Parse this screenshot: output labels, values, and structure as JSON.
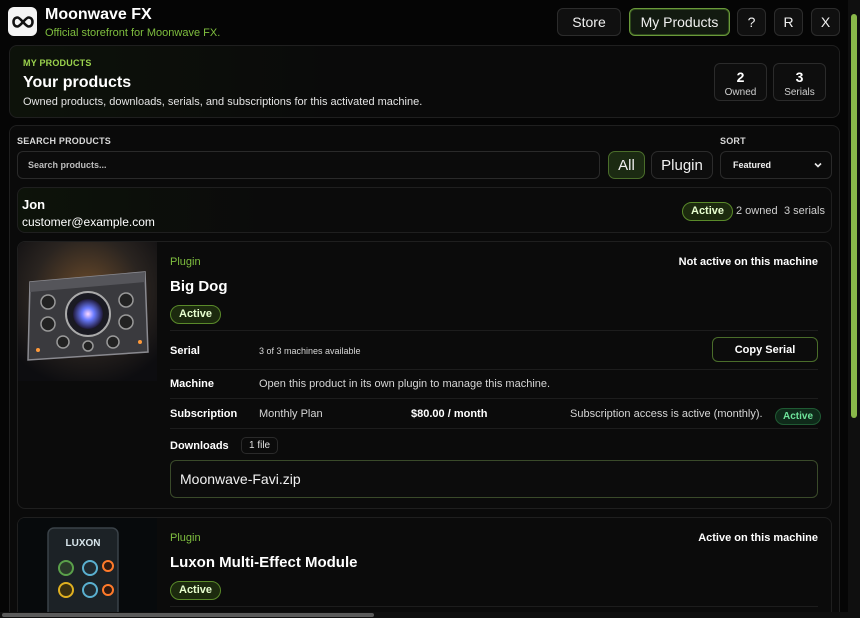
{
  "app": {
    "title": "Moonwave FX",
    "subtitle": "Official storefront for Moonwave FX."
  },
  "nav": {
    "store": "Store",
    "my_products": "My Products",
    "help": "?",
    "r": "R",
    "close": "X"
  },
  "hero": {
    "eyebrow": "MY PRODUCTS",
    "title": "Your products",
    "description": "Owned products, downloads, serials, and subscriptions for this activated machine.",
    "stats": [
      {
        "value": "2",
        "label": "Owned"
      },
      {
        "value": "3",
        "label": "Serials"
      }
    ]
  },
  "filters": {
    "search_label": "SEARCH PRODUCTS",
    "search_placeholder": "Search products...",
    "chips": [
      "All",
      "Plugin"
    ],
    "sort_label": "SORT",
    "sort_value": "Featured"
  },
  "account": {
    "name": "Jon",
    "email": "customer@example.com",
    "status": "Active",
    "owned": "2 owned",
    "serials": "3 serials"
  },
  "products": [
    {
      "category": "Plugin",
      "machine_status": "Not active on this machine",
      "title": "Big Dog",
      "status": "Active",
      "serial_label": "Serial",
      "serial_info": "3 of 3 machines available",
      "copy_serial": "Copy Serial",
      "machine_label": "Machine",
      "machine_info": "Open this product in its own plugin to manage this machine.",
      "subscription_label": "Subscription",
      "plan": "Monthly Plan",
      "price": "$80.00 / month",
      "subscription_info": "Subscription access is active (monthly).",
      "subscription_status": "Active",
      "downloads_label": "Downloads",
      "file_count": "1 file",
      "file_name": "Moonwave-Favi.zip"
    },
    {
      "category": "Plugin",
      "machine_status": "Active on this machine",
      "title": "Luxon Multi-Effect Module",
      "status": "Active",
      "thumb_text": "LUXON"
    }
  ],
  "colors": {
    "accent": "#7fbf3f",
    "background": "#050505",
    "panel": "#0a0a0a"
  }
}
